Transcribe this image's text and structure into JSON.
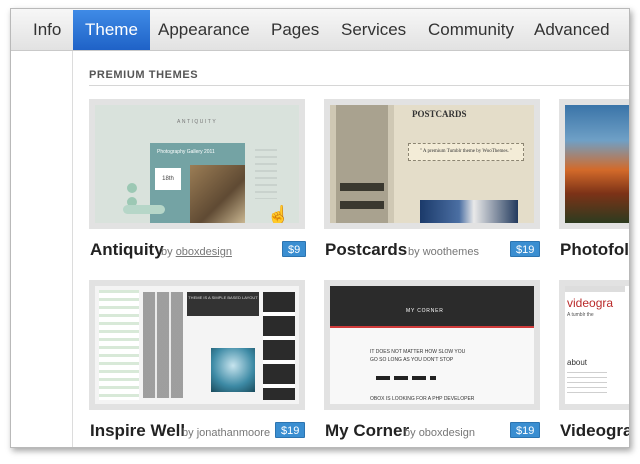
{
  "tabs": [
    {
      "label": "Info",
      "active": false
    },
    {
      "label": "Theme",
      "active": true
    },
    {
      "label": "Appearance",
      "active": false
    },
    {
      "label": "Pages",
      "active": false
    },
    {
      "label": "Services",
      "active": false
    },
    {
      "label": "Community",
      "active": false
    },
    {
      "label": "Advanced",
      "active": false
    }
  ],
  "section": {
    "title": "PREMIUM THEMES"
  },
  "themes": [
    {
      "name": "Antiquity",
      "by": "by",
      "author": "oboxdesign",
      "price": "$9"
    },
    {
      "name": "Postcards",
      "by": "by",
      "author": "woothemes",
      "price": "$19"
    },
    {
      "name": "Photofol",
      "by": "",
      "author": "",
      "price": ""
    },
    {
      "name": "Inspire Well",
      "by": "by",
      "author": "jonathanmoore",
      "price": "$19"
    },
    {
      "name": "My Corner",
      "by": "by",
      "author": "oboxdesign",
      "price": "$19"
    },
    {
      "name": "Videogra",
      "by": "",
      "author": "",
      "price": ""
    }
  ],
  "thumbs": {
    "antiquity": {
      "title": "ANTIQUITY",
      "panel_title": "Photography Gallery 2011",
      "date": "18th"
    },
    "postcards": {
      "brand": "POSTCARDS",
      "quote": "\" A premium Tumblr theme by WooThemes. \""
    },
    "inspire": {
      "hero": "THEME IS A SIMPLE BASED LAYOUT"
    },
    "mycorner": {
      "header": "MY CORNER",
      "line1": "IT DOES NOT MATTER HOW SLOW YOU",
      "line2": "GO SO LONG AS YOU DON'T STOP",
      "line3": "OBOX IS LOOKING FOR A PHP DEVELOPER"
    },
    "video": {
      "title": "videogra",
      "subtitle": "A tumblr the",
      "about": "about"
    }
  },
  "colors": {
    "active_tab": "#2f78d8",
    "price_badge": "#3a8ed1"
  }
}
